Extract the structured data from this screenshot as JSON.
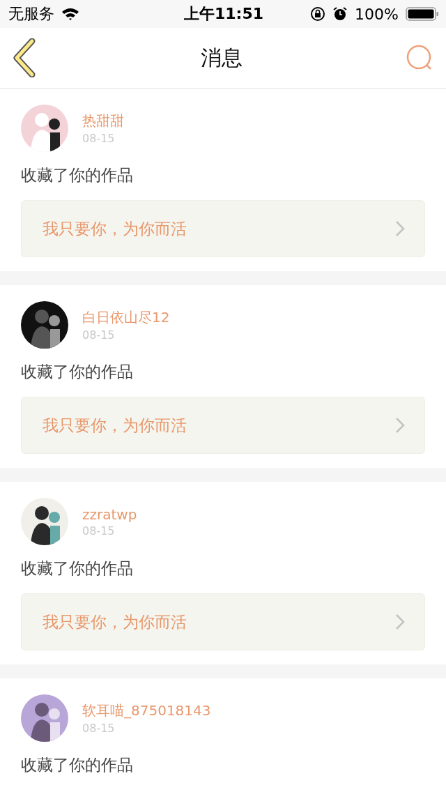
{
  "status_bar": {
    "carrier": "无服务",
    "time": "上午11:51",
    "battery": "100%"
  },
  "nav": {
    "title": "消息"
  },
  "messages": [
    {
      "user": "热甜甜",
      "date": "08-15",
      "action": "收藏了你的作品",
      "quote": "我只要你，为你而活"
    },
    {
      "user": "白日依山尽12",
      "date": "08-15",
      "action": "收藏了你的作品",
      "quote": "我只要你，为你而活"
    },
    {
      "user": "zzratwp",
      "date": "08-15",
      "action": "收藏了你的作品",
      "quote": "我只要你，为你而活"
    },
    {
      "user": "软耳喵_875018143",
      "date": "08-15",
      "action": "收藏了你的作品"
    }
  ]
}
